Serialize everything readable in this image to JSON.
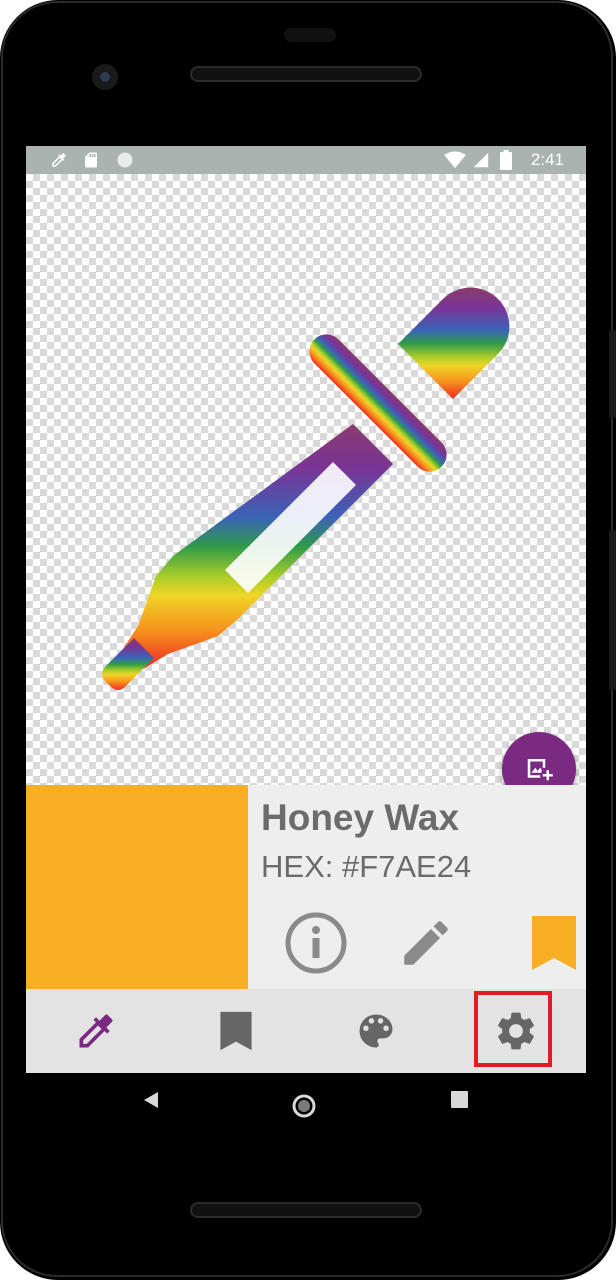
{
  "status_bar": {
    "notification_icons": [
      "eyedropper-icon",
      "sd-card-icon",
      "circle-icon"
    ],
    "system_icons": [
      "wifi-icon",
      "signal-icon",
      "battery-icon"
    ],
    "time": "2:41"
  },
  "canvas": {
    "image_description_icon": "eyedropper-rainbow-icon",
    "fab_icon": "add-image-icon"
  },
  "color_info": {
    "name": "Honey Wax",
    "hex_label": "HEX: #F7AE24",
    "swatch_color": "#F7AE24",
    "actions": [
      {
        "icon": "info-icon",
        "color": "#8a8a8a"
      },
      {
        "icon": "pencil-icon",
        "color": "#8a8a8a"
      },
      {
        "icon": "bookmark-icon",
        "color": "#F7AE24"
      }
    ]
  },
  "bottom_nav": {
    "items": [
      {
        "icon": "eyedropper-icon",
        "active": true,
        "color": "#7b2a82"
      },
      {
        "icon": "bookmark-icon",
        "active": false,
        "color": "#666666"
      },
      {
        "icon": "palette-icon",
        "active": false,
        "color": "#666666"
      },
      {
        "icon": "gear-icon",
        "active": false,
        "color": "#666666"
      }
    ],
    "highlighted_item": "gear-icon",
    "highlight_color": "#e31b23"
  },
  "system_nav": {
    "buttons": [
      "back-icon",
      "home-icon",
      "recents-icon"
    ]
  },
  "colors": {
    "accent": "#7b2a82",
    "status_bar": "#aab3b0",
    "panel_bg": "#eeeeee",
    "nav_bg": "#e3e3e3"
  }
}
